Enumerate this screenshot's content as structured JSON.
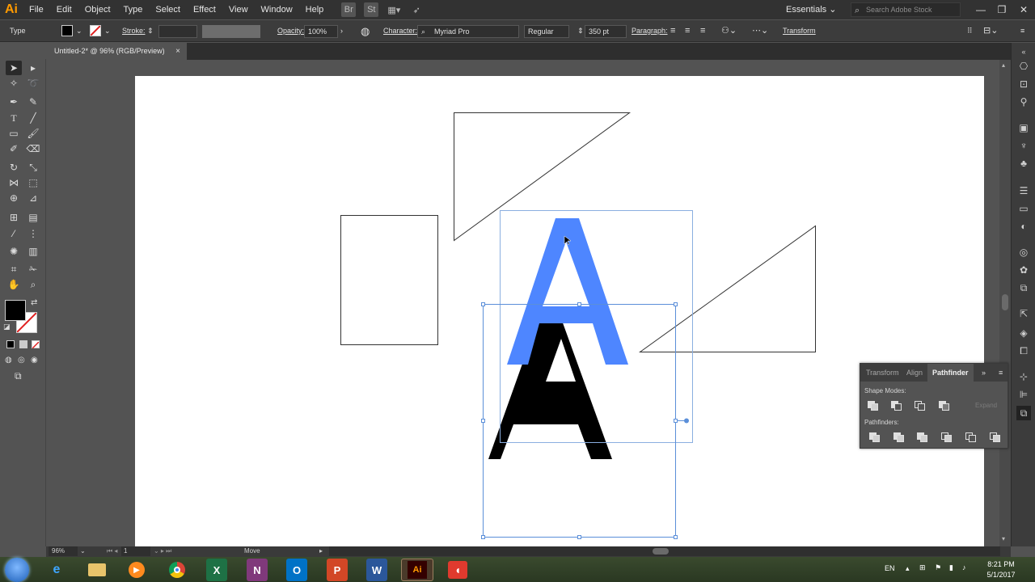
{
  "app": {
    "logo": "Ai"
  },
  "menu": [
    "File",
    "Edit",
    "Object",
    "Type",
    "Select",
    "Effect",
    "View",
    "Window",
    "Help"
  ],
  "menubar_right": {
    "workspace": "Essentials",
    "search_placeholder": "Search Adobe Stock"
  },
  "control": {
    "selection_label": "Type",
    "stroke_label": "Stroke:",
    "opacity_label": "Opacity:",
    "opacity_value": "100%",
    "character_label": "Character:",
    "font_family": "Myriad Pro",
    "font_style": "Regular",
    "font_size": "350 pt",
    "paragraph_label": "Paragraph:",
    "transform_label": "Transform"
  },
  "document_tab": {
    "title": "Untitled-2* @ 96% (RGB/Preview)",
    "close": "×"
  },
  "artwork": {
    "glyph": "A",
    "glyph_top_color": "#4e86ff",
    "glyph_bottom_color": "#000000",
    "selection_color": "#5b8fd9"
  },
  "pathfinder": {
    "tabs": [
      "Transform",
      "Align",
      "Pathfinder"
    ],
    "active_tab": "Pathfinder",
    "shape_modes_label": "Shape Modes:",
    "pathfinders_label": "Pathfinders:",
    "expand_label": "Expand"
  },
  "statusbar": {
    "zoom": "96%",
    "artboard": "1",
    "status_text": "Move"
  },
  "taskbar": {
    "apps": [
      "ie-icon",
      "file-explorer-icon",
      "media-player-icon",
      "chrome-icon",
      "excel-icon",
      "onenote-icon",
      "outlook-icon",
      "powerpoint-icon",
      "word-icon",
      "illustrator-icon",
      "app-red-icon"
    ],
    "app_letters": {
      "excel": "X",
      "onenote": "N",
      "outlook": "O",
      "powerpoint": "P",
      "word": "W",
      "illustrator": "Ai"
    },
    "language": "EN",
    "time": "8:21 PM",
    "date": "5/1/2017"
  },
  "colors": {
    "accent": "#4e86ff",
    "menubar": "#323232",
    "panel": "#535353"
  }
}
